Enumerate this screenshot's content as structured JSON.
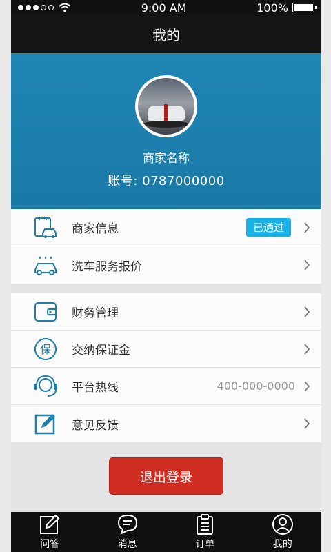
{
  "status_bar": {
    "time": "9:00 AM",
    "battery": "100%",
    "battery_level": 1.0
  },
  "nav": {
    "title": "我的"
  },
  "profile": {
    "name": "商家名称",
    "account": "账号: 0787000000"
  },
  "menu_group_1": [
    {
      "icon": "merchant-car-icon",
      "label": "商家信息",
      "badge": "已通过"
    },
    {
      "icon": "car-wash-icon",
      "label": "洗车服务报价"
    }
  ],
  "menu_group_2": [
    {
      "icon": "wallet-icon",
      "label": "财务管理"
    },
    {
      "icon": "deposit-shield-icon",
      "label": "交纳保证金"
    },
    {
      "icon": "headset-icon",
      "label": "平台热线",
      "hint": "400-000-0000"
    },
    {
      "icon": "feedback-edit-icon",
      "label": "意见反馈"
    }
  ],
  "logout": {
    "label": "退出登录"
  },
  "tabs": [
    {
      "icon": "qa-edit-icon",
      "label": "问答"
    },
    {
      "icon": "message-bubble-icon",
      "label": "消息"
    },
    {
      "icon": "order-clipboard-icon",
      "label": "订单"
    },
    {
      "icon": "user-profile-icon",
      "label": "我的"
    }
  ],
  "colors": {
    "accent": "#1f86b4",
    "badge": "#18b1e6",
    "logout": "#cf2d22",
    "icon": "#1f7ea8"
  }
}
